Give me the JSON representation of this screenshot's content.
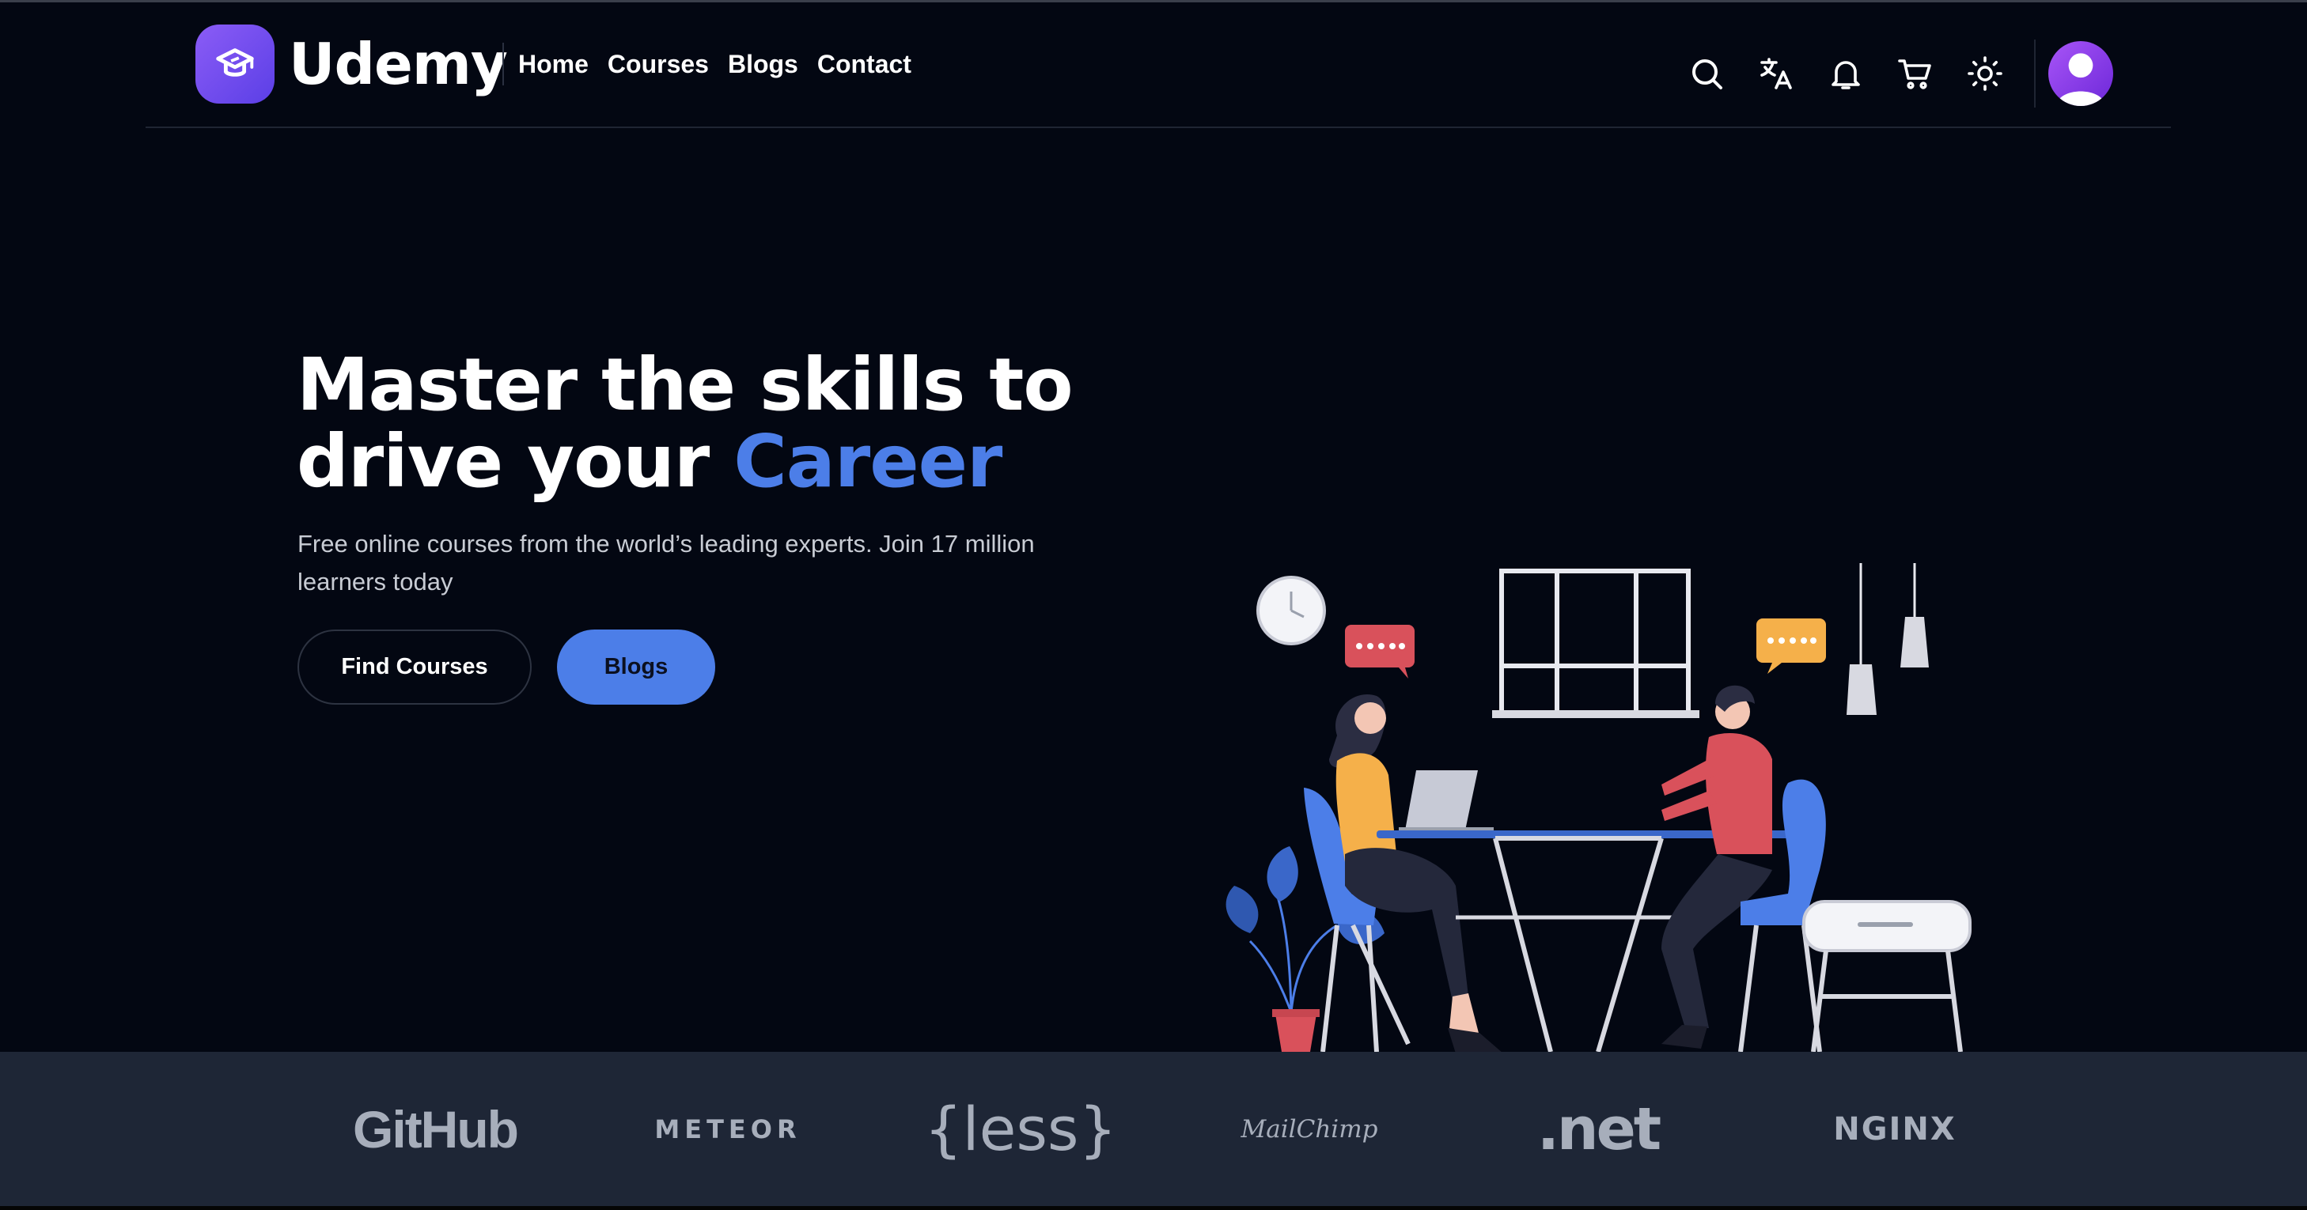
{
  "brand": {
    "name": "Udemy"
  },
  "nav": {
    "links": [
      "Home",
      "Courses",
      "Blogs",
      "Contact"
    ],
    "icons": [
      "search-icon",
      "translate-icon",
      "bell-icon",
      "cart-icon",
      "sun-icon"
    ],
    "avatar": "user-avatar-icon"
  },
  "hero": {
    "title_line1": "Master the skills to",
    "title_line2_prefix": "drive your ",
    "title_accent": "Career",
    "subtitle": "Free online courses from the world’s leading experts. Join 17 million learners today",
    "primary_cta": "Blogs",
    "secondary_cta": "Find Courses"
  },
  "partners": [
    "GitHub",
    "METEOR",
    "{less}",
    "MailChimp",
    ".net",
    "NGINX"
  ],
  "colors": {
    "background": "#030712",
    "accent": "#4c7ee8",
    "brand_purple": "#7c4dff",
    "strip": "#1e2636"
  }
}
